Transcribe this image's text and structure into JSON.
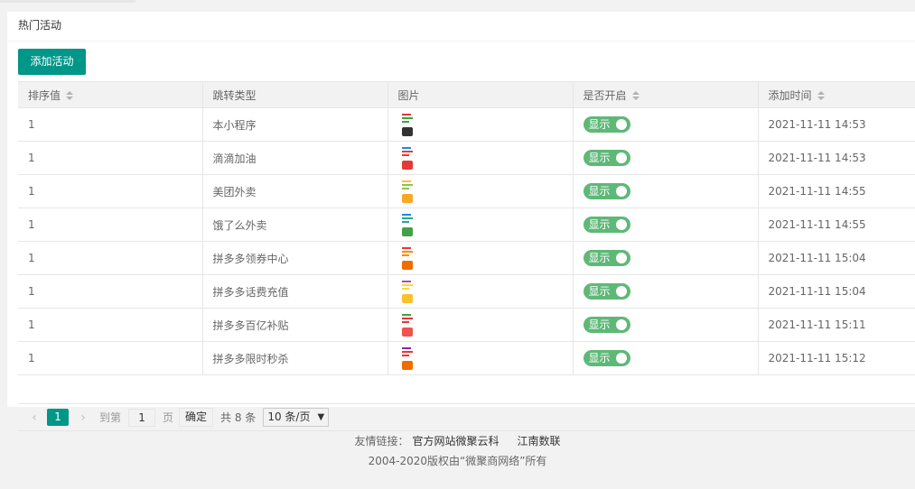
{
  "card": {
    "title": "热门活动"
  },
  "toolbar": {
    "add_label": "添加活动"
  },
  "table": {
    "headers": [
      "排序值",
      "跳转类型",
      "图片",
      "是否开启",
      "添加时间"
    ],
    "rows": [
      {
        "sort": "1",
        "type": "本小程序",
        "status": "显示",
        "time": "2021-11-11 14:53"
      },
      {
        "sort": "1",
        "type": "滴滴加油",
        "status": "显示",
        "time": "2021-11-11 14:53"
      },
      {
        "sort": "1",
        "type": "美团外卖",
        "status": "显示",
        "time": "2021-11-11 14:55"
      },
      {
        "sort": "1",
        "type": "饿了么外卖",
        "status": "显示",
        "time": "2021-11-11 14:55"
      },
      {
        "sort": "1",
        "type": "拼多多领券中心",
        "status": "显示",
        "time": "2021-11-11 15:04"
      },
      {
        "sort": "1",
        "type": "拼多多话费充值",
        "status": "显示",
        "time": "2021-11-11 15:04"
      },
      {
        "sort": "1",
        "type": "拼多多百亿补贴",
        "status": "显示",
        "time": "2021-11-11 15:11"
      },
      {
        "sort": "1",
        "type": "拼多多限时秒杀",
        "status": "显示",
        "time": "2021-11-11 15:12"
      }
    ]
  },
  "pager": {
    "prev_icon": "chevron-left-icon",
    "current": "1",
    "next_icon": "chevron-right-icon",
    "goto_label": "到第",
    "page_value": "1",
    "page_unit": "页",
    "ok_label": "确定",
    "total": "共 8 条",
    "limit": "10 条/页"
  },
  "footer": {
    "links_label": "友情链接：",
    "link1": "官方网站微聚云科",
    "link2": "江南数联",
    "copyright": "2004-2020版权由“微聚商网络”所有"
  },
  "colors": {
    "primary": "#009688",
    "switch_on": "#5fb878"
  }
}
